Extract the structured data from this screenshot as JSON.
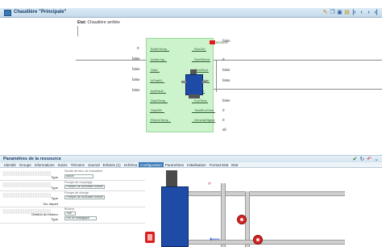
{
  "window": {
    "title": "Chaudière \"Principale\""
  },
  "toolbar": {
    "icons": [
      "pencil-icon",
      "copy-icon",
      "save-icon",
      "first-icon",
      "prev-icon",
      "next-icon",
      "last-icon"
    ]
  },
  "status": {
    "label": "Etat:",
    "value": "Chaudière arrêtée"
  },
  "block": {
    "title": "BOILER",
    "inputs": [
      "BoilerTemp",
      "Active inp",
      "Start",
      "InFault1",
      "AckFault",
      "StartTemp",
      "StartDE",
      "ReturnTemp"
    ],
    "outputs": [
      "RunCtrl",
      "RunWhere",
      "RunWhat",
      "SpecSolar",
      "Defeat",
      "FunTime",
      "TotalRunTime",
      "GeneralSignal"
    ],
    "ext_in": [
      "0",
      "false",
      "false",
      "false",
      "false",
      "",
      "",
      ""
    ],
    "ext_out": [
      "false",
      "0",
      "false",
      "false",
      "",
      "false",
      "0",
      "0",
      "all"
    ]
  },
  "panel": {
    "title": "Paramètres de la ressource",
    "tabs": [
      "Identité",
      "Groupe",
      "Informations",
      "Suivis",
      "Témoins",
      "Journal",
      "Enfants (1)",
      "Schéma",
      "Configuration",
      "Paramètres",
      "Initialisation",
      "Format Etat",
      "Etat"
    ],
    "active_tab": "Configuration",
    "form": {
      "subtitle1": "Sonde de bloc de chaudière",
      "type_label": "Type",
      "type_value": "aucun",
      "subtitle2": "Pompe de recyclage",
      "pump_type": "Pompes de circulation double",
      "subtitle3": "Pompe de charge",
      "pump2_type": "Pompes de circulation double",
      "retour_label": "Sur départ",
      "subtitle4": "Brûleur",
      "burner_label": "Gestion du brûleur",
      "burner_value": "Tout",
      "burner_type_label": "Type",
      "burner_type_value": "Feu en analogique"
    }
  },
  "diagram": {
    "temp_label": "T°"
  },
  "colors": {
    "block_bg": "#ccf3cc",
    "boiler_blue": "#1d4ba5",
    "pump_red": "#d42525",
    "accent": "#3a78b5"
  }
}
